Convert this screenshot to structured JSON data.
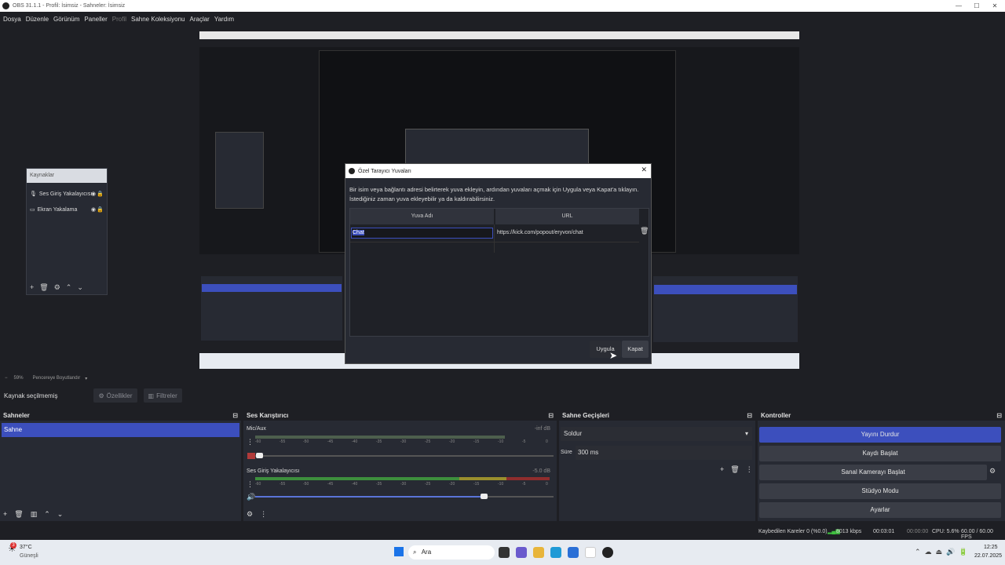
{
  "window": {
    "title": "OBS 31.1.1 - Profil: İsimsiz - Sahneler: İsimsiz",
    "minimize": "—",
    "maximize": "☐",
    "close": "✕"
  },
  "menu": {
    "items": [
      "Dosya",
      "Düzenle",
      "Görünüm",
      "Paneller",
      "Profil",
      "Sahne Koleksiyonu",
      "Araçlar",
      "Yardım"
    ]
  },
  "preview": {
    "sources_panel": {
      "title": "Kaynaklar",
      "items": [
        {
          "label": "Ses Giriş Yakalayıcısı"
        },
        {
          "label": "Ekran Yakalama"
        }
      ]
    }
  },
  "dialog": {
    "title": "Özel Tarayıcı Yuvaları",
    "description": "Bir isim veya bağlantı adresi belirterek yuva ekleyin, ardından yuvaları açmak için Uygula veya Kapat'a tıklayın. İstediğiniz zaman yuva ekleyebilir ya da kaldırabilirsiniz.",
    "col_name": "Yuva Adı",
    "col_url": "URL",
    "row_name": "Chat",
    "row_url": "https://kick.com/popout/eryvon/chat",
    "apply": "Uygula",
    "close": "Kapat"
  },
  "zoom": {
    "value": "59%",
    "fit_label": "Pencereye Boyutlandır"
  },
  "source_bar": {
    "no_source": "Kaynak seçilmemiş",
    "properties": "Özellikler",
    "filters": "Filtreler"
  },
  "scenes": {
    "title": "Sahneler",
    "items": [
      "Sahne"
    ]
  },
  "mixer": {
    "title": "Ses Karıştırıcı",
    "channels": [
      {
        "name": "Mic/Aux",
        "db": "-inf dB"
      },
      {
        "name": "Ses Giriş Yakalayıcısı",
        "db": "-5.0 dB"
      }
    ],
    "ticks": [
      "-60",
      "-55",
      "-50",
      "-45",
      "-40",
      "-35",
      "-30",
      "-25",
      "-20",
      "-15",
      "-10",
      "-5",
      "0"
    ]
  },
  "transitions": {
    "title": "Sahne Geçişleri",
    "selected": "Soldur",
    "duration_label": "Süre",
    "duration": "300 ms"
  },
  "controls": {
    "title": "Kontroller",
    "buttons": [
      "Yayını Durdur",
      "Kaydı Başlat",
      "Sanal Kamerayı Başlat",
      "Stüdyo Modu",
      "Ayarlar"
    ]
  },
  "status": {
    "dropped": "Kaybedilen Kareler 0 (%0.0)",
    "bitrate": "8013 kbps",
    "stream_time": "00:03:01",
    "rec_time": "00:00:00",
    "cpu": "CPU: 5.6%",
    "fps": "60.00 / 60.00 FPS"
  },
  "taskbar": {
    "weather_temp": "37°C",
    "weather_desc": "Güneşli",
    "weather_badge": "3",
    "search": "Ara",
    "time": "12:25",
    "date": "22.07.2025"
  },
  "colors": {
    "accent": "#3c4fbd",
    "panel": "#272a33",
    "background": "#1e1f24"
  }
}
